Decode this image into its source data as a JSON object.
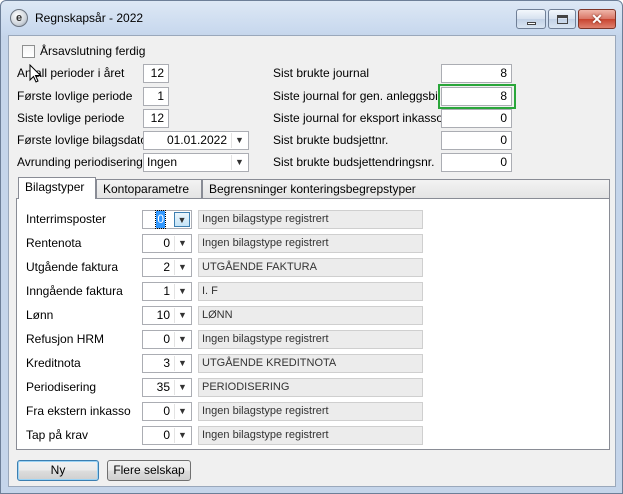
{
  "window": {
    "title": "Regnskapsår - 2022"
  },
  "header": {
    "year_closed_label": "Årsavslutning ferdig",
    "fields": [
      {
        "label": "Antall perioder i året",
        "value": "12"
      },
      {
        "label": "Første lovlige periode",
        "value": "1"
      },
      {
        "label": "Siste lovlige periode",
        "value": "12"
      },
      {
        "label": "Første lovlige bilagsdato",
        "value": "01.01.2022"
      },
      {
        "label": "Avrunding periodisering",
        "value": "Ingen"
      }
    ],
    "right_fields": [
      {
        "label": "Sist brukte journal",
        "value": "8"
      },
      {
        "label": "Siste journal for gen. anleggsbilag",
        "value": "8"
      },
      {
        "label": "Siste journal for eksport inkasso",
        "value": "0"
      },
      {
        "label": "Sist brukte budsjettnr.",
        "value": "0"
      },
      {
        "label": "Sist brukte budsjettendringsnr.",
        "value": "0"
      }
    ]
  },
  "tabs": [
    {
      "label": "Bilagstyper"
    },
    {
      "label": "Kontoparametre"
    },
    {
      "label": "Begrensninger konteringsbegrepstyper"
    }
  ],
  "bilagstyper": [
    {
      "label": "Interrimsposter",
      "value": "0",
      "desc": "Ingen bilagstype registrert"
    },
    {
      "label": "Rentenota",
      "value": "0",
      "desc": "Ingen bilagstype registrert"
    },
    {
      "label": "Utgående faktura",
      "value": "2",
      "desc": "UTGÅENDE FAKTURA"
    },
    {
      "label": "Inngående faktura",
      "value": "1",
      "desc": "I. F"
    },
    {
      "label": "Lønn",
      "value": "10",
      "desc": "LØNN"
    },
    {
      "label": "Refusjon HRM",
      "value": "0",
      "desc": "Ingen bilagstype registrert"
    },
    {
      "label": "Kreditnota",
      "value": "3",
      "desc": "UTGÅENDE KREDITNOTA"
    },
    {
      "label": "Periodisering",
      "value": "35",
      "desc": "PERIODISERING"
    },
    {
      "label": "Fra ekstern inkasso",
      "value": "0",
      "desc": "Ingen bilagstype registrert"
    },
    {
      "label": "Tap på krav",
      "value": "0",
      "desc": "Ingen bilagstype registrert"
    }
  ],
  "buttons": {
    "new": "Ny",
    "more_companies": "Flere selskap"
  }
}
